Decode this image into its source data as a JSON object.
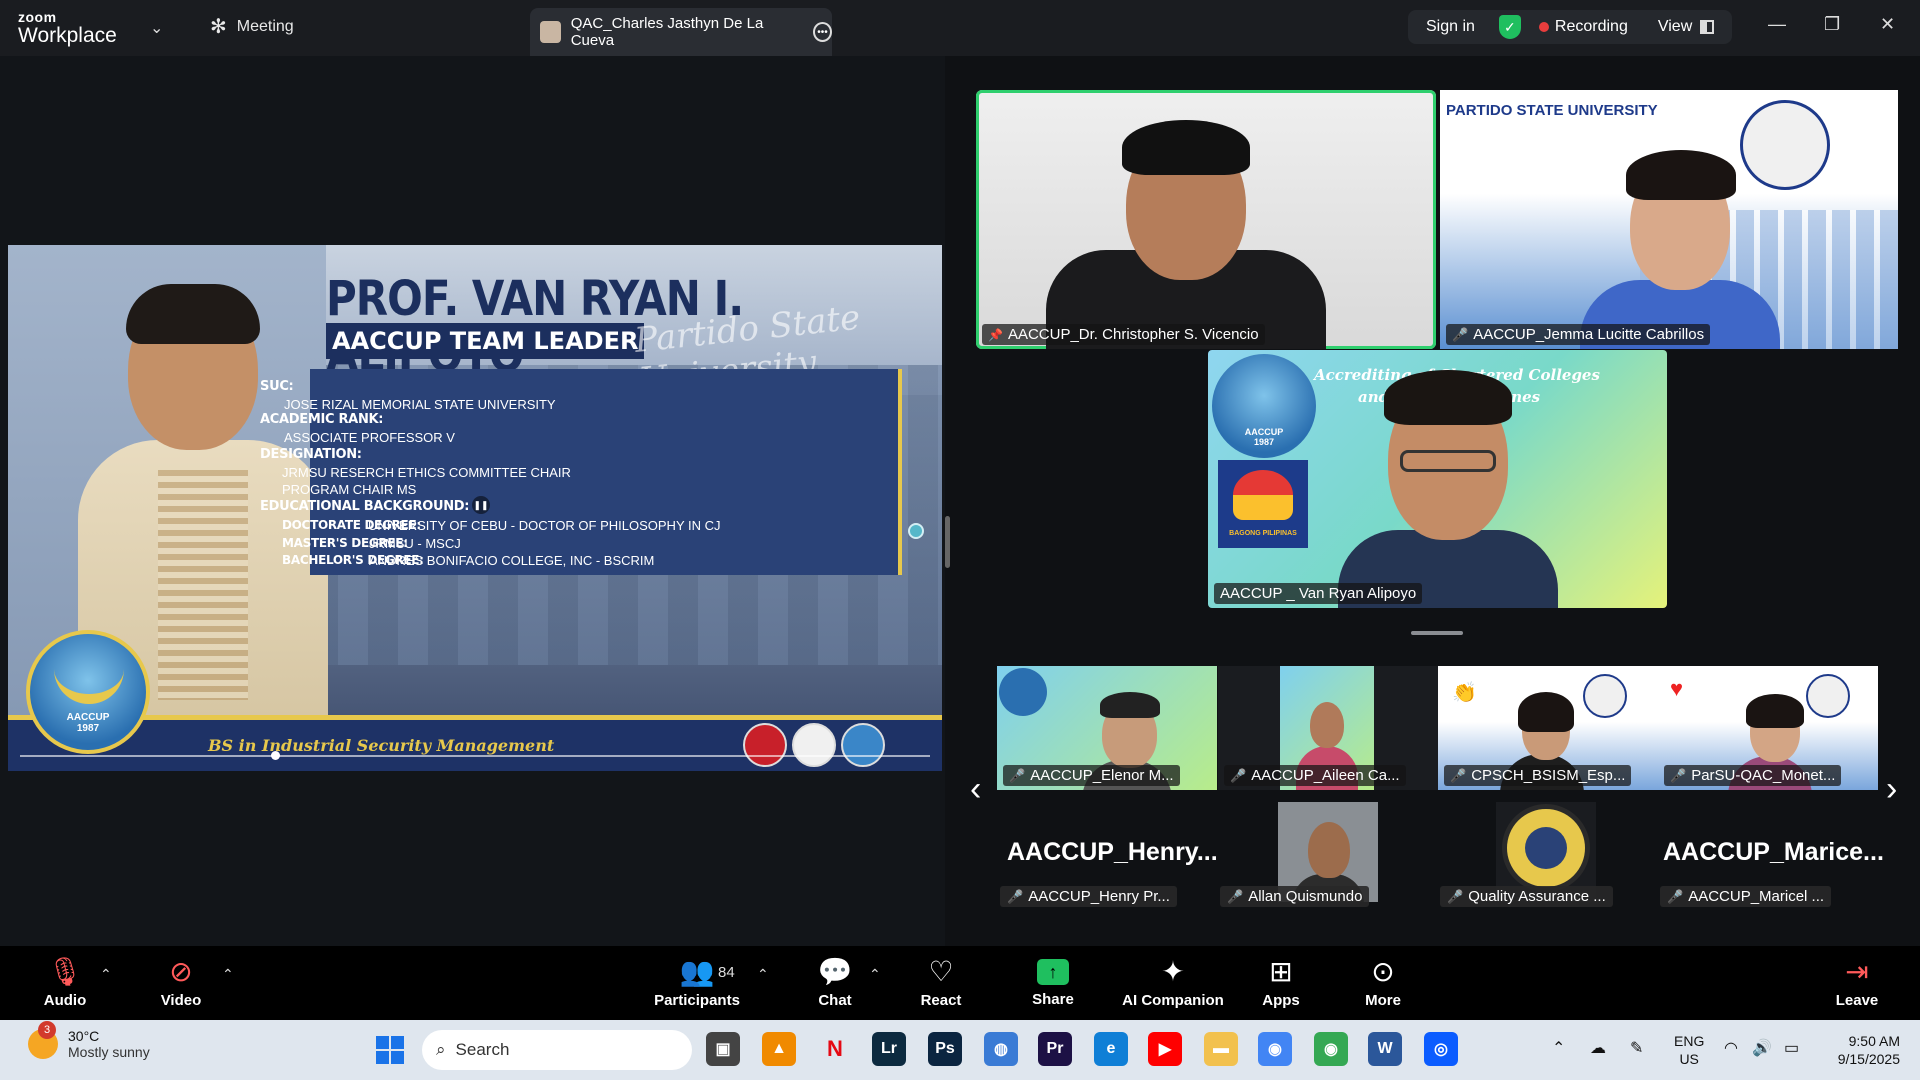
{
  "app": {
    "brand_small": "zoom",
    "brand_large": "Workplace",
    "meeting_tab": "Meeting",
    "active_tab": "QAC_Charles Jasthyn De La Cueva",
    "sign_in": "Sign in",
    "recording": "Recording",
    "view": "View",
    "colors": {
      "accent_green": "#2fcf6e",
      "recording_red": "#e93d3d"
    }
  },
  "slide": {
    "name": "PROF. VAN RYAN I. ALIPOYO",
    "role": "AACCUP TEAM LEADER",
    "script_text": "Partido State University",
    "suc_label": "SUC:",
    "suc_value": "JOSE RIZAL MEMORIAL STATE UNIVERSITY",
    "rank_label": "ACADEMIC RANK:",
    "rank_value": "ASSOCIATE PROFESSOR V",
    "designation_label": "DESIGNATION:",
    "designation_1": "JRMSU RESERCH ETHICS COMMITTEE CHAIR",
    "designation_2": "PROGRAM CHAIR MS",
    "edu_label": "EDUCATIONAL BACKGROUND:",
    "doctorate_label": "DOCTORATE DEGREE:",
    "doctorate_value": "UNIVERSITY OF CEBU - DOCTOR OF PHILOSOPHY IN CJ",
    "masters_label": "MASTER'S DEGREE:",
    "masters_value": "JRMSU - MSCJ",
    "bachelors_label": "BACHELOR'S DEGREE:",
    "bachelors_value": "ANDRES BONIFACIO COLLEGE, INC - BSCRIM",
    "footer": "BS in Industrial Security Management",
    "logo_text": "AACCUP",
    "logo_year": "1987",
    "progress": 0.28
  },
  "tiles": {
    "t1": "AACCUP_Dr. Christopher S. Vicencio",
    "t2": "AACCUP_Jemma Lucitte Cabrillos",
    "t2_banner": "PARTIDO STATE UNIVERSITY",
    "t3": "AACCUP _ Van Ryan Alipoyo",
    "t3_banner_1": "Accrediting    of Chartered Colleges",
    "t3_banner_2": "and U        the Philippines",
    "t3_logo_text": "AACCUP",
    "t3_logo_year": "1987",
    "t3_bagong": "BAGONG PILIPINAS"
  },
  "gallery": {
    "row1": [
      "AACCUP_Elenor M...",
      "AACCUP_Aileen Ca...",
      "CPSCH_BSISM_Esp...",
      "ParSU-QAC_Monet..."
    ],
    "row2_big": [
      "AACCUP_Henry...",
      "AACCUP_Marice..."
    ],
    "row2": [
      "AACCUP_Henry Pr...",
      "Allan Quismundo",
      "Quality Assurance ...",
      "AACCUP_Maricel ..."
    ]
  },
  "toolbar": {
    "audio": "Audio",
    "video": "Video",
    "participants": "Participants",
    "participant_count": "84",
    "chat": "Chat",
    "react": "React",
    "share": "Share",
    "ai": "AI Companion",
    "apps": "Apps",
    "more": "More",
    "leave": "Leave"
  },
  "taskbar": {
    "weather_badge": "3",
    "temp": "30°C",
    "condition": "Mostly sunny",
    "search": "Search",
    "lang1": "ENG",
    "lang2": "US",
    "time": "9:50 AM",
    "date": "9/15/2025",
    "apps": [
      "file-explorer-icon",
      "vlc-icon",
      "netflix-icon",
      "lightroom-icon",
      "photoshop-icon",
      "browser-icon",
      "premiere-icon",
      "edge-icon",
      "youtube-icon",
      "folder-icon",
      "chrome-icon",
      "chrome-profile-icon",
      "word-icon",
      "zoom-icon"
    ]
  }
}
